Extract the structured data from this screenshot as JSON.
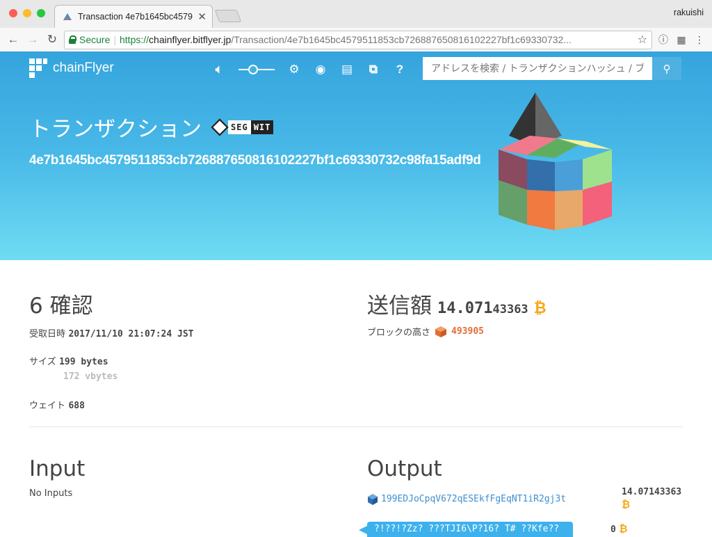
{
  "browser": {
    "tab_title": "Transaction 4e7b1645bc4579",
    "user": "rakuishi",
    "secure_label": "Secure",
    "url_scheme": "https://",
    "url_host": "chainflyer.bitflyer.jp",
    "url_path": "/Transaction/4e7b1645bc4579511853cb726887650816102227bf1c69330732..."
  },
  "header": {
    "brand": "chainFlyer",
    "search_placeholder": "アドレスを検索 / トランザクションハッシュ / ブ",
    "title": "トランザクション",
    "segwit_a": "SEG",
    "segwit_b": "WIT",
    "txid": "4e7b1645bc4579511853cb726887650816102227bf1c69330732c98fa15adf9d",
    "nav_icons": [
      "speaker-icon",
      "slider",
      "gear-icon",
      "eye-icon",
      "document-icon",
      "tags-icon",
      "help-icon"
    ]
  },
  "summary": {
    "confirmations": "6 確認",
    "received_label": "受取日時",
    "received_value": "2017/11/10 21:07:24 JST",
    "size_label": "サイズ",
    "size_value": "199 bytes",
    "vsize_value": "172 vbytes",
    "weight_label": "ウェイト",
    "weight_value": "688",
    "amount_label": "送信額",
    "amount_major": "14.071",
    "amount_minor": "43363",
    "block_height_label": "ブロックの高さ",
    "block_height_value": "493905",
    "currency_symbol": "₿"
  },
  "input": {
    "heading": "Input",
    "empty": "No Inputs"
  },
  "output": {
    "heading": "Output",
    "items": [
      {
        "address": "199EDJoCpqV672qESEkfFgEqNT1iR2gj3t",
        "amount": "14.07143363"
      },
      {
        "address": "?!??!?Zz? ???TJI6\\P?16? T# ??Kfe??",
        "amount": "0"
      }
    ]
  },
  "colors": {
    "accent": "#35a4dd",
    "bitcoin": "#f7a81c",
    "link": "#3f8fcf",
    "block": "#e36c35"
  }
}
